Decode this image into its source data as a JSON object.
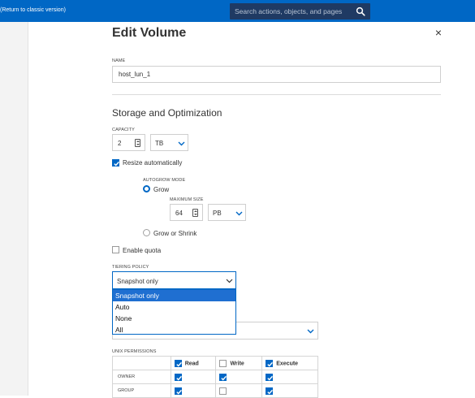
{
  "topbar": {
    "return_link": "Return to classic version",
    "search_placeholder": "Search actions, objects, and pages"
  },
  "dialog": {
    "title": "Edit Volume",
    "close_glyph": "×"
  },
  "name_field": {
    "label": "NAME",
    "value": "host_lun_1"
  },
  "storage": {
    "section_title": "Storage and Optimization",
    "capacity_label": "CAPACITY",
    "capacity_value": "2",
    "capacity_unit": "TB",
    "resize_label": "Resize automatically",
    "resize_checked": true,
    "autogrow_label": "AUTOGROW MODE",
    "grow_label": "Grow",
    "grow_selected": true,
    "max_size_label": "MAXIMUM SIZE",
    "max_size_value": "64",
    "max_size_unit": "PB",
    "grow_shrink_label": "Grow or Shrink",
    "grow_shrink_selected": false,
    "quota_label": "Enable quota",
    "quota_checked": false
  },
  "tiering": {
    "label": "TIERING POLICY",
    "selected": "Snapshot only",
    "options": [
      "Snapshot only",
      "Auto",
      "None",
      "All"
    ]
  },
  "permissions": {
    "label": "UNIX PERMISSIONS",
    "columns": [
      "Read",
      "Write",
      "Execute"
    ],
    "header_checked": [
      true,
      false,
      true
    ],
    "rows": [
      {
        "name": "OWNER",
        "checked": [
          true,
          true,
          true
        ]
      },
      {
        "name": "GROUP",
        "checked": [
          true,
          false,
          true
        ]
      }
    ]
  },
  "colors": {
    "accent": "#0067c5",
    "topbar": "#0067c5",
    "search_bg": "#1f3a63"
  },
  "icons": [
    "search-icon",
    "close-icon",
    "chevron-down-icon",
    "check-icon",
    "spinner-icon"
  ]
}
